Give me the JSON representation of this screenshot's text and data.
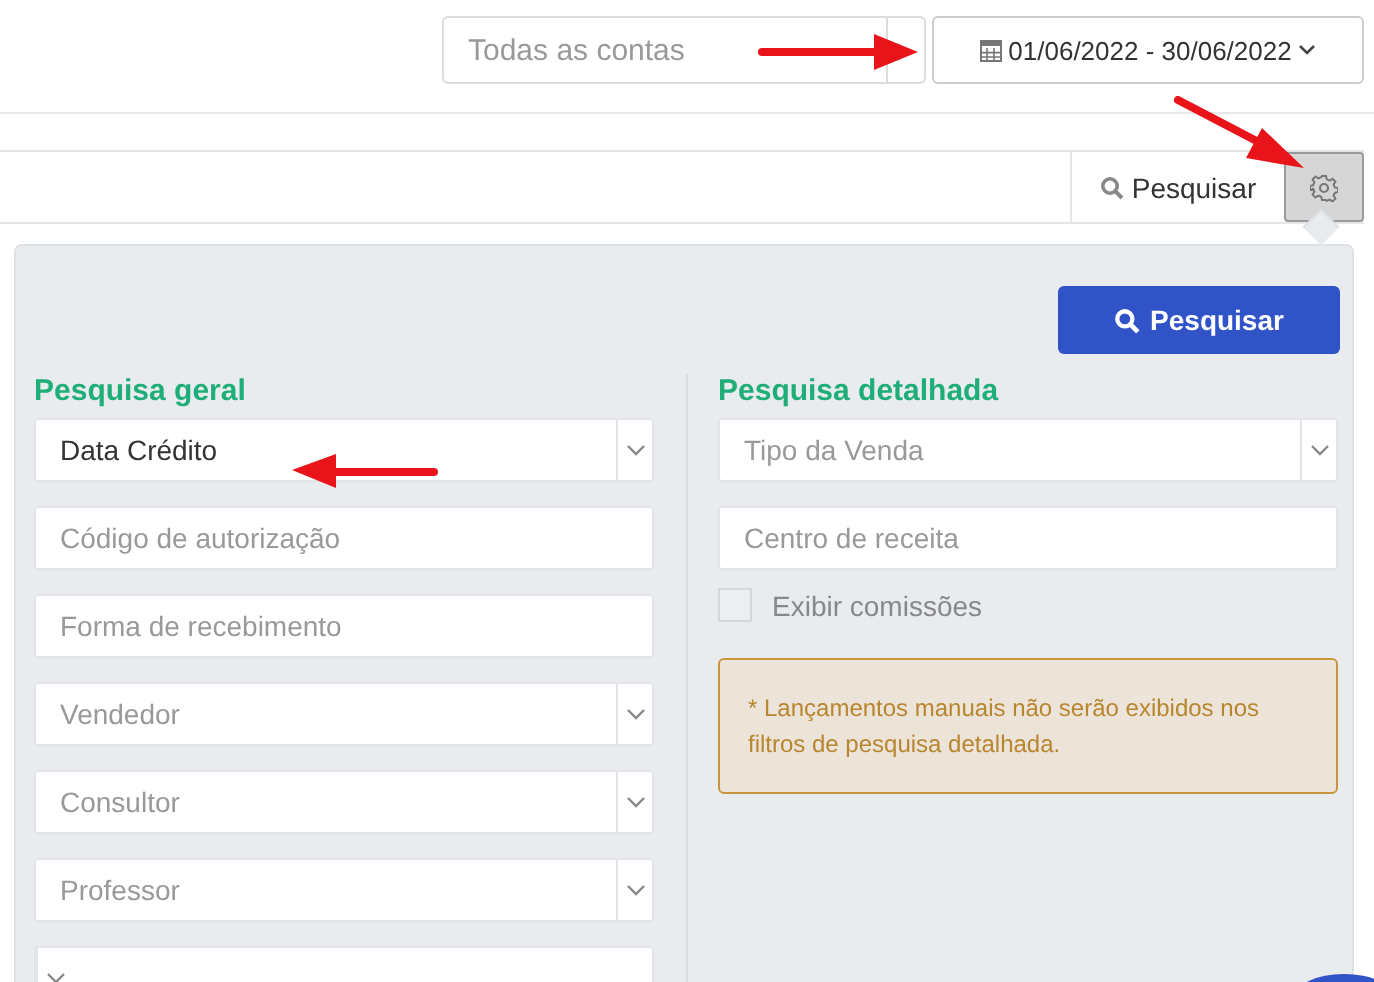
{
  "header": {
    "account_select": {
      "placeholder": "Todas as contas"
    },
    "date_range": "01/06/2022 - 30/06/2022"
  },
  "search_bar": {
    "search_button": "Pesquisar"
  },
  "filter_panel": {
    "submit_button": "Pesquisar",
    "general": {
      "title": "Pesquisa geral",
      "fields": [
        {
          "kind": "select",
          "value": "Data Crédito"
        },
        {
          "kind": "input",
          "placeholder": "Código de autorização"
        },
        {
          "kind": "input",
          "placeholder": "Forma de recebimento"
        },
        {
          "kind": "select",
          "placeholder": "Vendedor"
        },
        {
          "kind": "select",
          "placeholder": "Consultor"
        },
        {
          "kind": "select",
          "placeholder": "Professor"
        },
        {
          "kind": "select"
        }
      ]
    },
    "detailed": {
      "title": "Pesquisa detalhada",
      "fields": [
        {
          "kind": "select",
          "placeholder": "Tipo da Venda"
        },
        {
          "kind": "input",
          "placeholder": "Centro de receita"
        }
      ],
      "checkbox": {
        "label": "Exibir comissões",
        "checked": false
      },
      "note": "* Lançamentos manuais não serão exibidos nos filtros de pesquisa detalhada."
    }
  }
}
